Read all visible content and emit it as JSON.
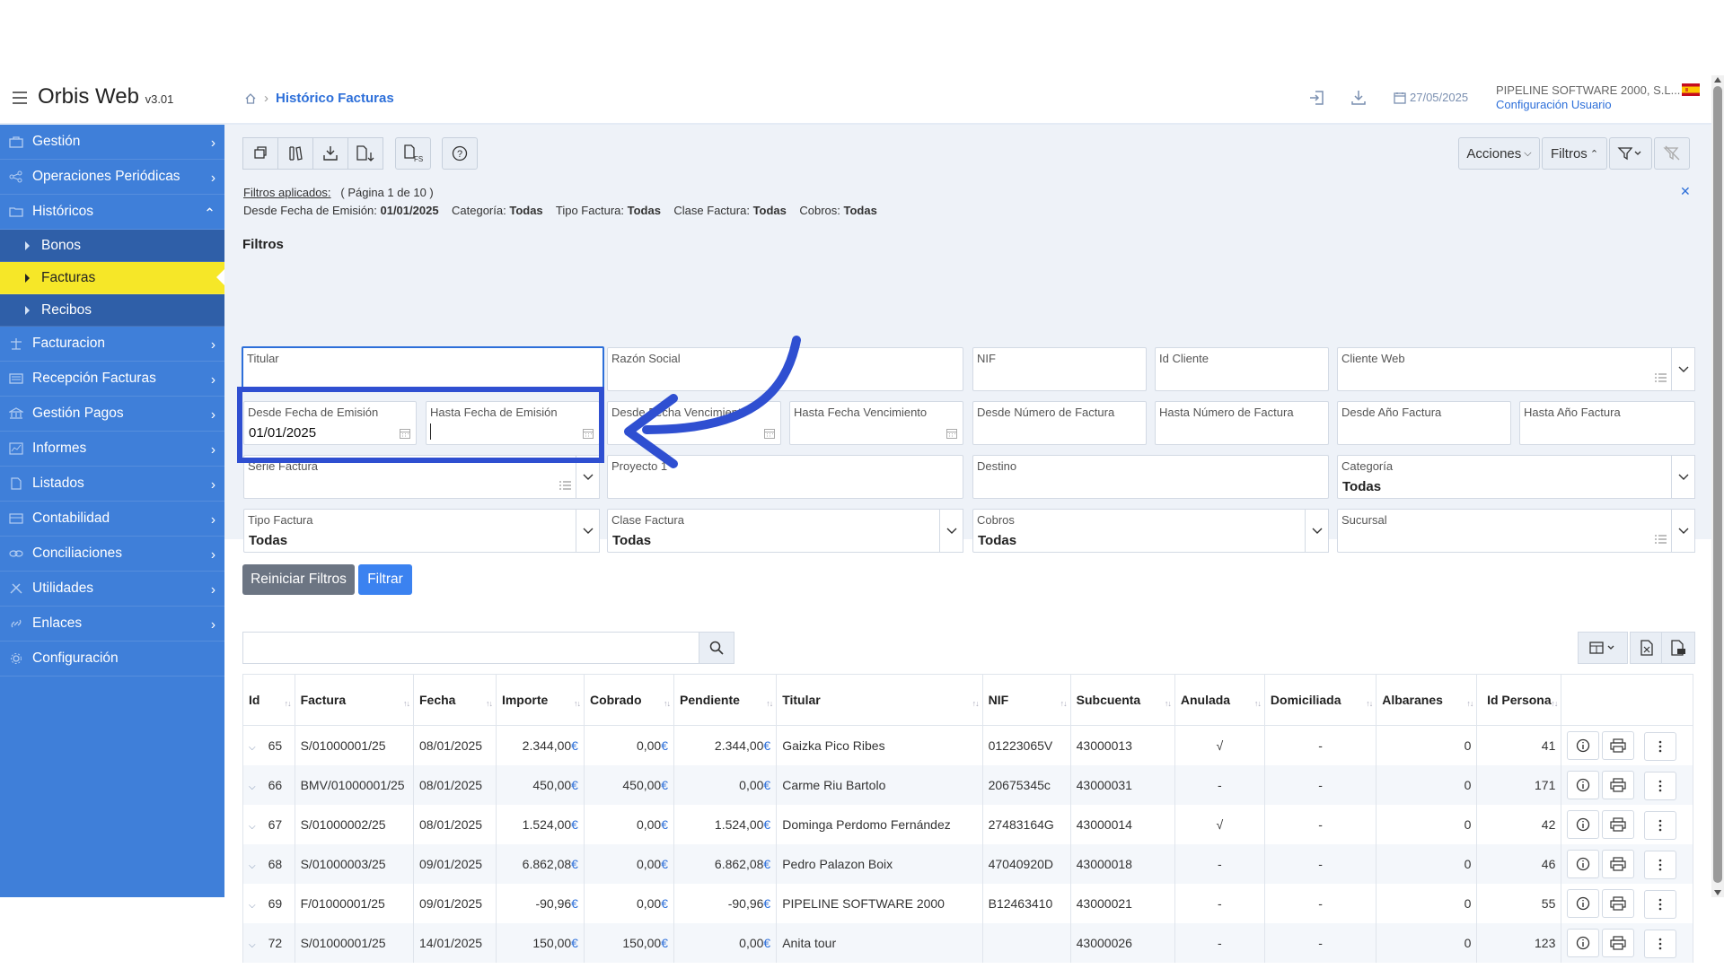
{
  "app": {
    "name": "Orbis Web",
    "version": "v3.01"
  },
  "breadcrumb": {
    "current": "Histórico Facturas"
  },
  "header": {
    "date": "27/05/2025",
    "company": "PIPELINE SOFTWARE 2000, S.L...",
    "config_link": "Configuración Usuario"
  },
  "sidebar": {
    "items": [
      {
        "label": "Gestión",
        "icon": "briefcase-icon"
      },
      {
        "label": "Operaciones Periódicas",
        "icon": "share-icon"
      },
      {
        "label": "Históricos",
        "icon": "folder-icon",
        "expanded": true
      },
      {
        "label": "Facturacion",
        "icon": "scale-icon"
      },
      {
        "label": "Recepción Facturas",
        "icon": "list-icon"
      },
      {
        "label": "Gestión Pagos",
        "icon": "bank-icon"
      },
      {
        "label": "Informes",
        "icon": "chart-icon"
      },
      {
        "label": "Listados",
        "icon": "document-icon"
      },
      {
        "label": "Contabilidad",
        "icon": "ledger-icon"
      },
      {
        "label": "Conciliaciones",
        "icon": "link-icon"
      },
      {
        "label": "Utilidades",
        "icon": "tools-icon"
      },
      {
        "label": "Enlaces",
        "icon": "chain-icon"
      },
      {
        "label": "Configuración",
        "icon": "gear-icon"
      }
    ],
    "sub": [
      "Bonos",
      "Facturas",
      "Recibos"
    ],
    "active_sub": "Facturas",
    "active_color": "#f6e728"
  },
  "toolbar": {
    "acciones": "Acciones",
    "filtros": "Filtros"
  },
  "applied": {
    "label": "Filtros aplicados:",
    "page": "( Página 1 de 10 )",
    "items": [
      {
        "k": "Desde Fecha de Emisión:",
        "v": "01/01/2025"
      },
      {
        "k": "Categoría:",
        "v": "Todas"
      },
      {
        "k": "Tipo Factura:",
        "v": "Todas"
      },
      {
        "k": "Clase Factura:",
        "v": "Todas"
      },
      {
        "k": "Cobros:",
        "v": "Todas"
      }
    ]
  },
  "filters": {
    "title": "Filtros",
    "titular": "Titular",
    "razon_social": "Razón Social",
    "nif": "NIF",
    "id_cliente": "Id Cliente",
    "cliente_web": "Cliente Web",
    "desde_emision": "Desde Fecha de Emisión",
    "desde_emision_value": "01/01/2025",
    "hasta_emision": "Hasta Fecha de Emisión",
    "desde_venc": "Desde Fecha Vencimiento",
    "hasta_venc": "Hasta Fecha Vencimiento",
    "desde_num": "Desde Número de Factura",
    "hasta_num": "Hasta Número de Factura",
    "desde_anio": "Desde Año Factura",
    "hasta_anio": "Hasta Año Factura",
    "serie": "Serie Factura",
    "proyecto": "Proyecto 1",
    "destino": "Destino",
    "categoria": "Categoría",
    "categoria_value": "Todas",
    "tipo": "Tipo Factura",
    "tipo_value": "Todas",
    "clase": "Clase Factura",
    "clase_value": "Todas",
    "cobros": "Cobros",
    "cobros_value": "Todas",
    "sucursal": "Sucursal",
    "reset": "Reiniciar Filtros",
    "apply": "Filtrar"
  },
  "table": {
    "columns": [
      "Id",
      "Factura",
      "Fecha",
      "Importe",
      "Cobrado",
      "Pendiente",
      "Titular",
      "NIF",
      "Subcuenta",
      "Anulada",
      "Domiciliada",
      "Albaranes",
      "Id Persona"
    ],
    "rows": [
      {
        "id": "65",
        "factura": "S/01000001/25",
        "fecha": "08/01/2025",
        "importe": "2.344,00",
        "cobrado": "0,00",
        "pendiente": "2.344,00",
        "titular": "Gaizka Pico Ribes",
        "nif": "01223065V",
        "subcuenta": "43000013",
        "anulada": "√",
        "domiciliada": "-",
        "albaranes": "0",
        "persona": "41"
      },
      {
        "id": "66",
        "factura": "BMV/01000001/25",
        "fecha": "08/01/2025",
        "importe": "450,00",
        "cobrado": "450,00",
        "pendiente": "0,00",
        "titular": "Carme Riu Bartolo",
        "nif": "20675345c",
        "subcuenta": "43000031",
        "anulada": "-",
        "domiciliada": "-",
        "albaranes": "0",
        "persona": "171"
      },
      {
        "id": "67",
        "factura": "S/01000002/25",
        "fecha": "08/01/2025",
        "importe": "1.524,00",
        "cobrado": "0,00",
        "pendiente": "1.524,00",
        "titular": "Dominga Perdomo Fernández",
        "nif": "27483164G",
        "subcuenta": "43000014",
        "anulada": "√",
        "domiciliada": "-",
        "albaranes": "0",
        "persona": "42"
      },
      {
        "id": "68",
        "factura": "S/01000003/25",
        "fecha": "09/01/2025",
        "importe": "6.862,08",
        "cobrado": "0,00",
        "pendiente": "6.862,08",
        "titular": "Pedro Palazon Boix",
        "nif": "47040920D",
        "subcuenta": "43000018",
        "anulada": "-",
        "domiciliada": "-",
        "albaranes": "0",
        "persona": "46"
      },
      {
        "id": "69",
        "factura": "F/01000001/25",
        "fecha": "09/01/2025",
        "importe": "-90,96",
        "cobrado": "0,00",
        "pendiente": "-90,96",
        "titular": "PIPELINE SOFTWARE 2000",
        "nif": "B12463410",
        "subcuenta": "43000021",
        "anulada": "-",
        "domiciliada": "-",
        "albaranes": "0",
        "persona": "55"
      },
      {
        "id": "72",
        "factura": "S/01000001/25",
        "fecha": "14/01/2025",
        "importe": "150,00",
        "cobrado": "150,00",
        "pendiente": "0,00",
        "titular": "Anita tour",
        "nif": "",
        "subcuenta": "43000026",
        "anulada": "-",
        "domiciliada": "-",
        "albaranes": "0",
        "persona": "123"
      }
    ],
    "currency": "€"
  },
  "colors": {
    "accent": "#3f7fd9",
    "annotation": "#2f4fd1"
  }
}
